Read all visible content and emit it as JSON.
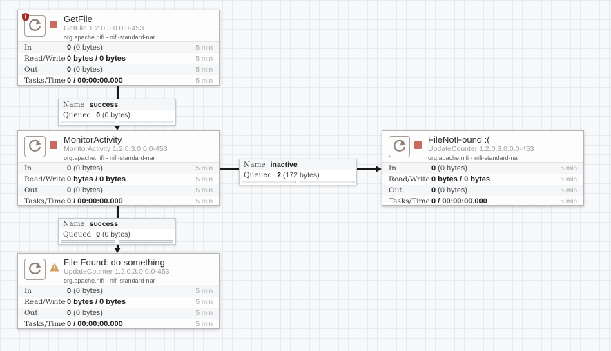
{
  "colors": {
    "stopped": "#c96b60",
    "invalid_warning": "#cf9f5d",
    "restricted_shield": "#9f2d27",
    "connection_line": "#1a1a1a"
  },
  "processors": [
    {
      "name": "GetFile",
      "type": "GetFile 1.2.0.3.0.0.0-453",
      "bundle": "org.apache.nifi - nifi-standard-nar",
      "state": "stopped",
      "restricted": true,
      "rows": [
        {
          "label": "In",
          "bold": "0",
          "rest": " (0 bytes)",
          "window": "5 min"
        },
        {
          "label": "Read/Write",
          "bold": "0 bytes / 0 bytes",
          "rest": "",
          "window": "5 min"
        },
        {
          "label": "Out",
          "bold": "0",
          "rest": " (0 bytes)",
          "window": "5 min"
        },
        {
          "label": "Tasks/Time",
          "bold": "0 / 00:00:00.000",
          "rest": "",
          "window": "5 min"
        }
      ]
    },
    {
      "name": "MonitorActivity",
      "type": "MonitorActivity 1.2.0.3.0.0.0-453",
      "bundle": "org.apache.nifi - nifi-standard-nar",
      "state": "stopped",
      "restricted": false,
      "rows": [
        {
          "label": "In",
          "bold": "0",
          "rest": " (0 bytes)",
          "window": "5 min"
        },
        {
          "label": "Read/Write",
          "bold": "0 bytes / 0 bytes",
          "rest": "",
          "window": "5 min"
        },
        {
          "label": "Out",
          "bold": "0",
          "rest": " (0 bytes)",
          "window": "5 min"
        },
        {
          "label": "Tasks/Time",
          "bold": "0 / 00:00:00.000",
          "rest": "",
          "window": "5 min"
        }
      ]
    },
    {
      "name": "FileNotFound :(",
      "type": "UpdateCounter 1.2.0.3.0.0.0-453",
      "bundle": "org.apache.nifi - nifi-standard-nar",
      "state": "stopped",
      "restricted": false,
      "rows": [
        {
          "label": "In",
          "bold": "0",
          "rest": " (0 bytes)",
          "window": "5 min"
        },
        {
          "label": "Read/Write",
          "bold": "0 bytes / 0 bytes",
          "rest": "",
          "window": "5 min"
        },
        {
          "label": "Out",
          "bold": "0",
          "rest": " (0 bytes)",
          "window": "5 min"
        },
        {
          "label": "Tasks/Time",
          "bold": "0 / 00:00:00.000",
          "rest": "",
          "window": "5 min"
        }
      ]
    },
    {
      "name": "File Found: do something",
      "type": "UpdateCounter 1.2.0.3.0.0.0-453",
      "bundle": "org.apache.nifi - nifi-standard-nar",
      "state": "invalid",
      "restricted": false,
      "rows": [
        {
          "label": "In",
          "bold": "0",
          "rest": " (0 bytes)",
          "window": "5 min"
        },
        {
          "label": "Read/Write",
          "bold": "0 bytes / 0 bytes",
          "rest": "",
          "window": "5 min"
        },
        {
          "label": "Out",
          "bold": "0",
          "rest": " (0 bytes)",
          "window": "5 min"
        },
        {
          "label": "Tasks/Time",
          "bold": "0 / 00:00:00.000",
          "rest": "",
          "window": "5 min"
        }
      ]
    }
  ],
  "connections": [
    {
      "name_label": "Name",
      "name": "success",
      "queued_label": "Queued",
      "queued_bold": "0",
      "queued_rest": " (0 bytes)"
    },
    {
      "name_label": "Name",
      "name": "inactive",
      "queued_label": "Queued",
      "queued_bold": "2",
      "queued_rest": " (172 bytes)"
    },
    {
      "name_label": "Name",
      "name": "success",
      "queued_label": "Queued",
      "queued_bold": "0",
      "queued_rest": " (0 bytes)"
    }
  ]
}
